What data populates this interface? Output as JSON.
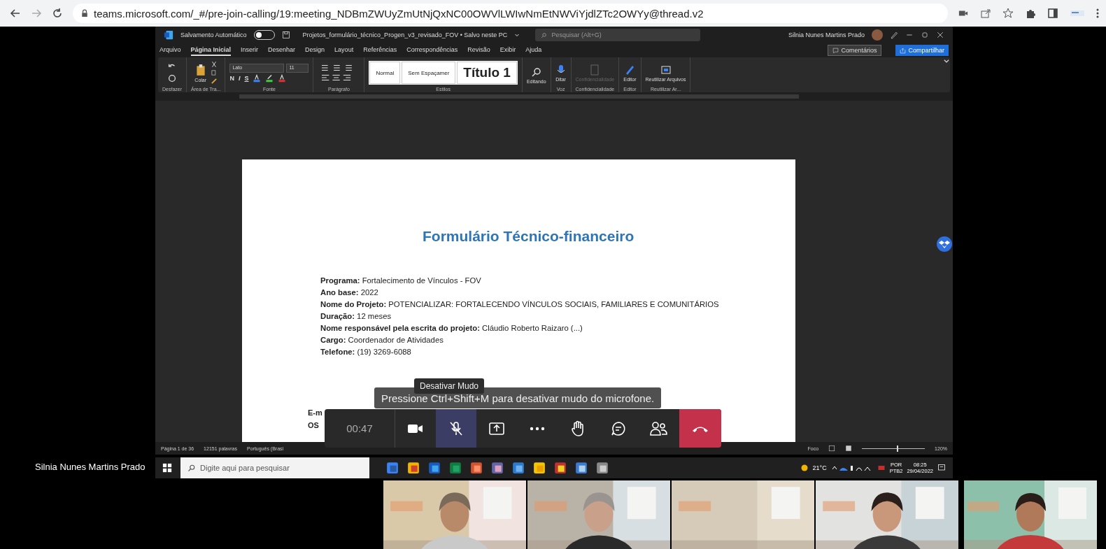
{
  "browser": {
    "url": "teams.microsoft.com/_#/pre-join-calling/19:meeting_NDBmZWUyZmUtNjQxNC00OWVlLWIwNmEtNWViYjdlZTc2OWYy@thread.v2"
  },
  "word": {
    "autosave_label": "Salvamento Automático",
    "autosave_on": false,
    "doc_title": "Projetos_formulário_técnico_Progen_v3_revisado_FOV • Salvo neste PC",
    "search_placeholder": "Pesquisar (Alt+G)",
    "user_name": "Silnia Nunes Martins Prado",
    "menu_tabs": [
      {
        "label": "Arquivo",
        "selected": false
      },
      {
        "label": "Página Inicial",
        "selected": true
      },
      {
        "label": "Inserir",
        "selected": false
      },
      {
        "label": "Desenhar",
        "selected": false
      },
      {
        "label": "Design",
        "selected": false
      },
      {
        "label": "Layout",
        "selected": false
      },
      {
        "label": "Referências",
        "selected": false
      },
      {
        "label": "Correspondências",
        "selected": false
      },
      {
        "label": "Revisão",
        "selected": false
      },
      {
        "label": "Exibir",
        "selected": false
      },
      {
        "label": "Ajuda",
        "selected": false
      }
    ],
    "comments_button": "Comentários",
    "share_button": "Compartilhar",
    "ribbon_groups": [
      {
        "kind": "undo",
        "label": "Desfazer"
      },
      {
        "kind": "clipboard",
        "label": "Área de Tra...",
        "button": "Colar"
      },
      {
        "kind": "font",
        "label": "Fonte",
        "font": "Lato",
        "size": "11",
        "format_buttons": [
          "N",
          "I",
          "S"
        ]
      },
      {
        "kind": "paragraph",
        "label": "Parágrafo"
      },
      {
        "kind": "styles",
        "label": "Estilos",
        "styles": [
          {
            "name": "Normal",
            "kind": "normal"
          },
          {
            "name": "Sem Espaçamer",
            "kind": "normal"
          },
          {
            "name": "Título 1",
            "kind": "heading"
          }
        ]
      },
      {
        "kind": "editing",
        "button": "Editando",
        "disabled": false
      },
      {
        "kind": "voice",
        "label": "Voz",
        "button": "Ditar",
        "disabled": false
      },
      {
        "kind": "sensitivity",
        "label": "Confidencialidade",
        "button": "Confidencialidade",
        "disabled": true
      },
      {
        "kind": "editor",
        "label": "Editor",
        "button": "Editor",
        "disabled": false
      },
      {
        "kind": "reuse",
        "label": "Reutilizar Ar...",
        "button": "Reutilizar Arquivos",
        "disabled": false
      }
    ],
    "page": {
      "title": "Formulário Técnico-financeiro",
      "fields": [
        {
          "label": "Programa:",
          "value": "Fortalecimento de Vínculos - FOV"
        },
        {
          "label": "Ano base:",
          "value": "2022"
        },
        {
          "label": "Nome do Projeto:",
          "value": " POTENCIALIZAR: FORTALECENDO VÍNCULOS SOCIAIS, FAMILIARES E COMUNITÁRIOS"
        },
        {
          "label": "Duração:",
          "value": "12 meses"
        },
        {
          "label": "Nome responsável pela escrita do projeto:",
          "value": "Cláudio Roberto Raizaro (...)"
        },
        {
          "label": "Cargo:",
          "value": "Coordenador de Atividades"
        },
        {
          "label": "Telefone:",
          "value": "(19) 3269-6088"
        }
      ],
      "covered_labels": [
        "E-m",
        "OS"
      ]
    },
    "status_bar": {
      "page": "Página 1 de 36",
      "words": "12151 palavras",
      "language": "Português (Brasi",
      "focus": "Foco",
      "zoom": "120%",
      "level": 0.55
    }
  },
  "presenter_name": "Silnia Nunes Martins Prado",
  "taskbar": {
    "search_placeholder": "Digite aqui para pesquisar",
    "weather": "21°C",
    "language": "POR",
    "layout": "PTB2",
    "time": "08:25",
    "date": "29/04/2022"
  },
  "call_toolbar": {
    "timer": "00:47",
    "buttons": [
      {
        "kind": "camera",
        "selected": false
      },
      {
        "kind": "mic",
        "selected": true
      },
      {
        "kind": "share",
        "selected": false
      },
      {
        "kind": "more",
        "selected": false
      },
      {
        "kind": "hand",
        "selected": false
      },
      {
        "kind": "chat",
        "selected": false
      },
      {
        "kind": "people",
        "selected": false
      },
      {
        "kind": "leave",
        "selected": false
      }
    ]
  },
  "tooltip": "Desativar Mudo",
  "hint": "Pressione Ctrl+Shift+M para desativar mudo do microfone."
}
